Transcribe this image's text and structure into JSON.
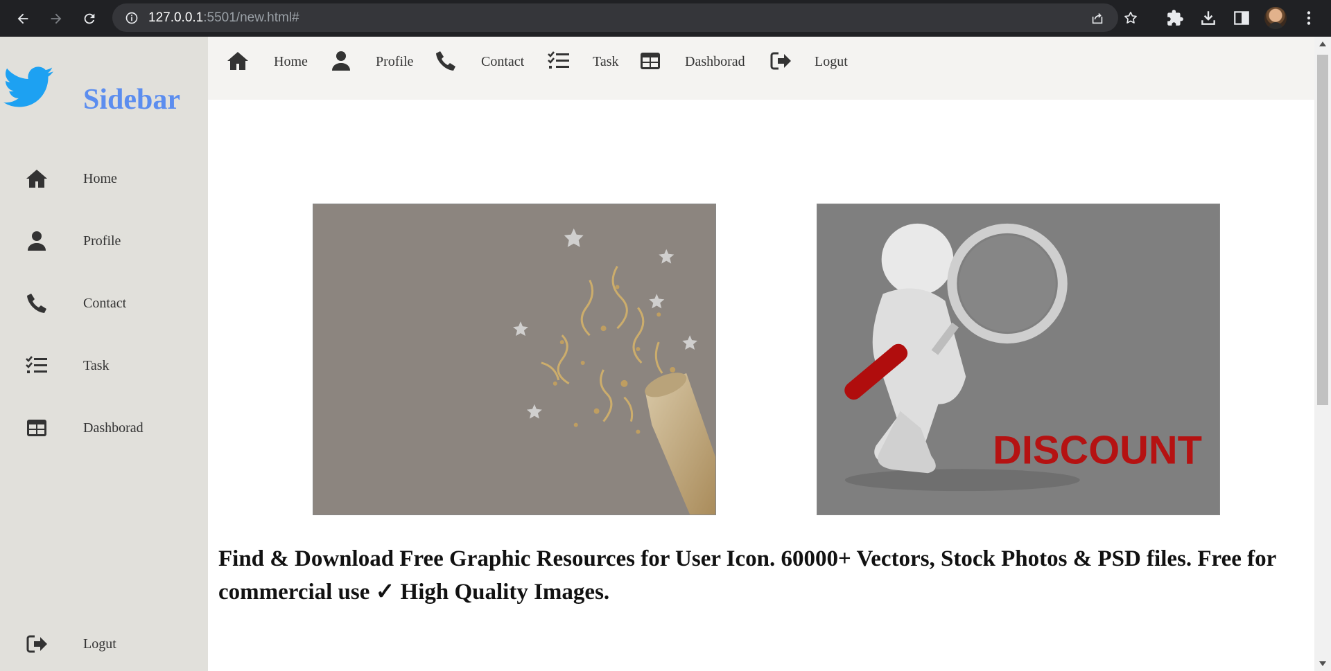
{
  "browser": {
    "url_host": "127.0.0.1",
    "url_rest": ":5501/new.html#"
  },
  "sidebar": {
    "title": "Sidebar",
    "logo_icon": "twitter-bird-icon",
    "brand_color": "#5b8def",
    "items": [
      {
        "label": "Home",
        "icon": "home-icon"
      },
      {
        "label": "Profile",
        "icon": "user-icon"
      },
      {
        "label": "Contact",
        "icon": "phone-icon"
      },
      {
        "label": "Task",
        "icon": "task-list-icon"
      },
      {
        "label": "Dashborad",
        "icon": "table-icon"
      }
    ],
    "logout": {
      "label": "Logut",
      "icon": "sign-out-icon"
    }
  },
  "topnav": {
    "items": [
      {
        "label": "Home",
        "icon": "home-icon"
      },
      {
        "label": "Profile",
        "icon": "user-icon"
      },
      {
        "label": "Contact",
        "icon": "phone-icon"
      },
      {
        "label": "Task",
        "icon": "task-list-icon"
      },
      {
        "label": "Dashborad",
        "icon": "table-icon"
      },
      {
        "label": "Logut",
        "icon": "sign-out-icon"
      }
    ]
  },
  "content": {
    "images": [
      {
        "description_icon": "champagne-confetti-image"
      },
      {
        "description_icon": "magnifier-discount-image",
        "overlay_text": "DISCOUNT"
      }
    ],
    "headline": "Find & Download Free Graphic Resources for User Icon. 60000+ Vectors, Stock Photos & PSD files. Free for commercial use ✓ High Quality Images."
  }
}
